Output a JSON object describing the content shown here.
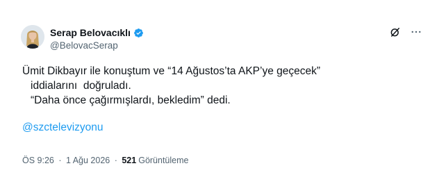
{
  "author": {
    "display_name": "Serap Belovacıklı",
    "handle": "@BelovacSerap",
    "verified": true
  },
  "icons": {
    "verified": "verified-badge-icon",
    "grok": "grok-icon",
    "more": "more-options-icon"
  },
  "tweet": {
    "line1": "Ümit Dikbayır ile konuştum ve “14 Ağustos’ta AKP’ye geçecek”",
    "line2": "iddialarını  doğruladı.",
    "line3": "“Daha önce çağırmışlardı, bekledim” dedi.",
    "mention": "@szctelevizyonu"
  },
  "meta": {
    "time": "ÖS 9:26",
    "separator1": " · ",
    "date": "1 Ağu 2026",
    "separator2": " · ",
    "views_count": "521",
    "views_label": "Görüntüleme"
  },
  "colors": {
    "accent": "#1d9bf0",
    "text": "#0f1419",
    "muted": "#536471"
  }
}
